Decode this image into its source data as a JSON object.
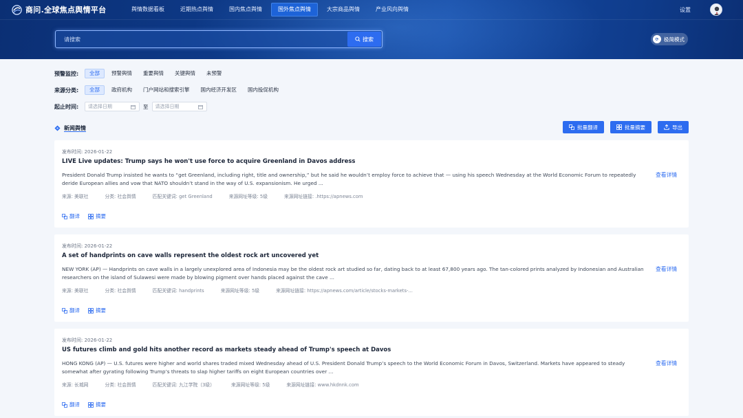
{
  "app": {
    "title": "商问.全球焦点舆情平台"
  },
  "nav": {
    "items": [
      "舆情数据看板",
      "近期热点舆情",
      "国内焦点舆情",
      "国外焦点舆情",
      "大宗商品舆情",
      "产业风向舆情"
    ],
    "active_index": 3,
    "settings_label": "设置"
  },
  "search": {
    "placeholder": "请搜索",
    "button_label": "搜索",
    "mode_label": "极简模式"
  },
  "filters": {
    "warning": {
      "label": "预警监控:",
      "options": [
        "全部",
        "预警舆情",
        "重要舆情",
        "关键舆情",
        "未预警"
      ],
      "active_index": 0
    },
    "source": {
      "label": "来源分类:",
      "options": [
        "全部",
        "政府机构",
        "门户网站和搜索引擎",
        "国内经济开发区",
        "国内投促机构"
      ],
      "active_index": 0
    },
    "date": {
      "label": "起止时间:",
      "start_placeholder": "请选择日期",
      "separator": "至",
      "end_placeholder": "请选择日期"
    }
  },
  "section": {
    "title": "新闻舆情",
    "actions": [
      "批量翻译",
      "批量摘要",
      "导出"
    ]
  },
  "articles": [
    {
      "date": "发布时间:  2026-01-22",
      "title": "LIVE Live updates: Trump says he won't use force to acquire Greenland in Davos address",
      "summary": "President Donald Trump insisted he wants to “get Greenland, including right, title and ownership,” but he said he wouldn’t employ force to achieve that — using his speech Wednesday at the World Economic Forum to repeatedly deride European allies and vow that NATO shouldn’t stand in the way of U.S. expansionism. He urged ...",
      "source": "来源:  美联社",
      "category": "分类:  社会舆情",
      "keyword": "匹配关键词:  get Greenland",
      "level": "来源网址等级:  5级",
      "link": "来源网址链接:  .https://apnews.com",
      "detail_label": "查看详情",
      "translate_label": "翻译",
      "summary_label": "摘要"
    },
    {
      "date": "发布时间:  2026-01-22",
      "title": "A set of handprints on cave walls represent the oldest rock art uncovered yet",
      "summary": "NEW YORK (AP) — Handprints on cave walls in a largely unexplored area of Indonesia may be the oldest rock art studied so far, dating back to at least 67,800 years ago. The tan-colored prints analyzed by Indonesian and Australian researchers on the island of Sulawesi were made by blowing pigment over hands placed against the cave ...",
      "source": "来源:  美联社",
      "category": "分类:  社会舆情",
      "keyword": "匹配关键词:  handprints",
      "level": "来源网址等级:  5级",
      "link": "来源网址链接:  https://apnews.com/article/stocks-markets-...",
      "detail_label": "查看详情",
      "translate_label": "翻译",
      "summary_label": "摘要"
    },
    {
      "date": "发布时间:  2026-01-22",
      "title": "US futures climb and gold hits another record as markets steady ahead of Trump's speech at Davos",
      "summary": "HONG KONG (AP) — U.S. futures were higher and world shares traded mixed Wednesday ahead of U.S. President Donald Trump’s speech to the World Economic Forum in Davos, Switzerland. Markets have appeared to steady somewhat after gyrating following Trump’s threats to slap higher tariffs on eight European countries over ...",
      "source": "来源:  长城网",
      "category": "分类:  社会舆情",
      "keyword": "匹配关键词:  九江学院（3级）",
      "level": "来源网址等级:  5级",
      "link": "来源网址链接:  www.hkdnnk.com",
      "detail_label": "查看详情",
      "translate_label": "翻译",
      "summary_label": "摘要"
    }
  ]
}
